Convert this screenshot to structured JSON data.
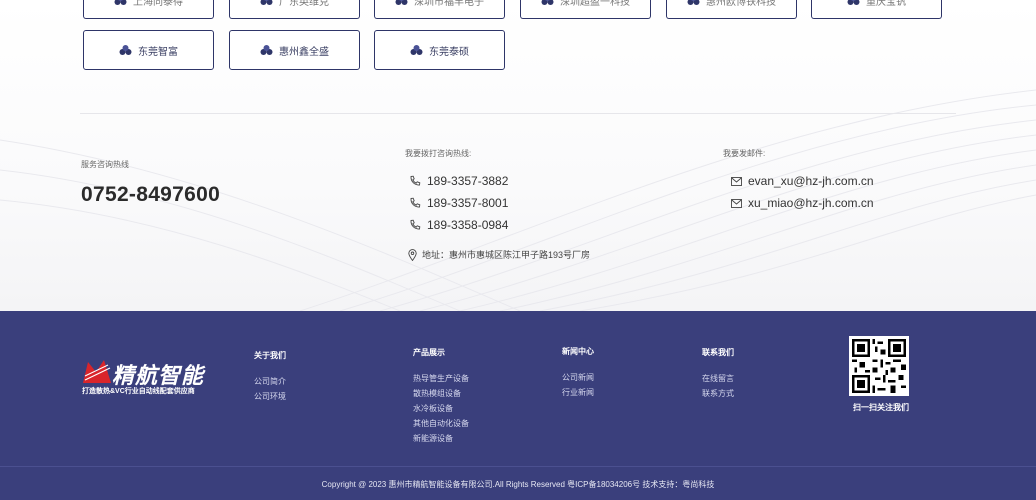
{
  "partners": {
    "row1": [
      "上海同泰得",
      "广东英维克",
      "深圳市福丰电子",
      "深圳超盈一科技",
      "惠州欧博铁科技",
      "重庆宝钒"
    ],
    "row2": [
      "东莞智富",
      "惠州鑫全盛",
      "东莞泰硕"
    ]
  },
  "contact": {
    "hotline_label": "服务咨询热线",
    "hotline": "0752-8497600",
    "phone_label": "我要拨打咨询热线:",
    "phones": [
      "189-3357-3882",
      "189-3357-8001",
      "189-3358-0984"
    ],
    "email_label": "我要发邮件:",
    "emails": [
      "evan_xu@hz-jh.com.cn",
      "xu_miao@hz-jh.com.cn"
    ],
    "address": "地址：惠州市惠城区陈江甲子路193号厂房"
  },
  "footer": {
    "logo_text": "精航智能",
    "slogan": "打造散热&VC行业自动线配套供应商",
    "about": {
      "title": "关于我们",
      "links": [
        "公司简介",
        "公司环境"
      ]
    },
    "products": {
      "title": "产品展示",
      "links": [
        "热导管生产设备",
        "散热模组设备",
        "水冷板设备",
        "其他自动化设备",
        "新能源设备"
      ]
    },
    "news": {
      "title": "新闻中心",
      "links": [
        "公司新闻",
        "行业新闻"
      ]
    },
    "contact": {
      "title": "联系我们",
      "links": [
        "在线留言",
        "联系方式"
      ]
    },
    "qr_caption": "扫一扫关注我们",
    "copyright": "Copyright @ 2023 惠州市精航智能设备有限公司.All Rights Reserved    粤ICP备18034206号    技术支持：粤尚科技"
  },
  "colors": {
    "footer_bg": "#3a3f7c",
    "button_border": "#2e3568",
    "logo_red": "#d9252b"
  }
}
